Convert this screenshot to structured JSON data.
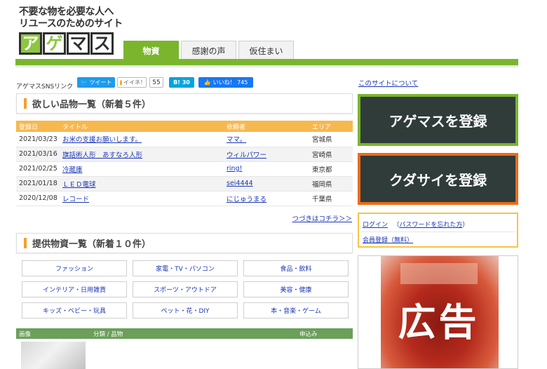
{
  "header": {
    "tagline_line1": "不要な物を必要な人へ",
    "tagline_line2": "リユースのためのサイト",
    "logo_chars": [
      "ア",
      "ゲ",
      "マ",
      "ス"
    ],
    "tabs": [
      {
        "label": "物資",
        "active": true
      },
      {
        "label": "感謝の声",
        "active": false
      },
      {
        "label": "仮住まい",
        "active": false
      }
    ]
  },
  "social": {
    "label": "アゲマスSNSリンク",
    "tweet": "ツイート",
    "iine": "イイネ！",
    "iine_count": "55",
    "hatena": "B! 30",
    "facebook": "いいね！ 745"
  },
  "wanted": {
    "heading": "欲しい品物一覧（新着５件）",
    "columns": [
      "登録日",
      "タイトル",
      "依頼者",
      "エリア"
    ],
    "rows": [
      {
        "date": "2021/03/23",
        "title": "お米の支援お願いします。",
        "requester": "ママ。",
        "area": "宮城県"
      },
      {
        "date": "2021/03/16",
        "title": "旗話術人形　あすなろ人形",
        "requester": "ウィルパワー",
        "area": "宮崎県"
      },
      {
        "date": "2021/02/25",
        "title": "冷蔵庫",
        "requester": "ring!",
        "area": "東京都"
      },
      {
        "date": "2021/01/18",
        "title": "ＬＥＤ電球",
        "requester": "sei4444",
        "area": "福岡県"
      },
      {
        "date": "2020/12/08",
        "title": "レコード",
        "requester": "にじゅうまる",
        "area": "千葉県"
      }
    ],
    "more_link": "つづきはコチラ＞＞"
  },
  "offered": {
    "heading": "提供物資一覧（新着１０件）",
    "categories": [
      "ファッション",
      "家電・TV・パソコン",
      "食品・飲料",
      "インテリア・日用雑貨",
      "スポーツ・アウトドア",
      "美容・健康",
      "キッズ・ベビー・玩具",
      "ペット・花・DIY",
      "本・音楽・ゲーム"
    ],
    "columns": [
      "画像",
      "分類 / 品物",
      "申込み"
    ]
  },
  "sidebar": {
    "about": "このサイトについて",
    "register_agemasu": "アゲマスを登録",
    "register_kudasai": "クダサイを登録",
    "login": "ログイン",
    "forgot_password": "パスワードを忘れた方",
    "signup": "会員登録（無料）",
    "ad_label": "広告"
  }
}
